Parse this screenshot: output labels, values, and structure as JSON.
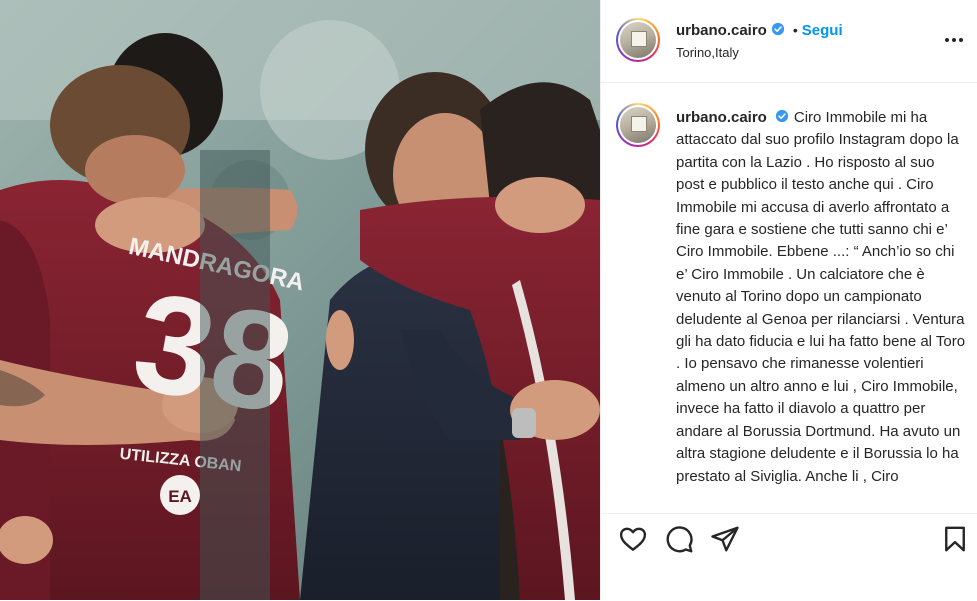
{
  "header": {
    "username": "urbano.cairo",
    "follow_label": "Segui",
    "location": "Torino,Italy"
  },
  "caption": {
    "username": "urbano.cairo",
    "text": "Ciro Immobile mi ha attaccato dal suo profilo Instagram dopo la partita con la Lazio . Ho risposto al suo post e pubblico il testo anche qui . Ciro Immobile mi accusa di averlo affrontato a fine gara e sostiene che tutti sanno chi e’ Ciro Immobile. Ebbene ...: “ Anch’io so chi e’ Ciro Immobile . Un calciatore che è venuto al Torino dopo un campionato deludente al Genoa per rilanciarsi . Ventura gli ha dato fiducia e lui ha fatto bene al Toro . Io pensavo che rimanesse volentieri almeno un altro anno e lui , Ciro Immobile, invece ha fatto il diavolo a quattro per andare al Borussia Dortmund. Ha avuto un altra stagione deludente e il Borussia lo ha prestato al Siviglia. Anche li , Ciro"
  },
  "photo": {
    "jersey_name": "MANDRAGORA",
    "jersey_number": "38",
    "sponsor": "UTILIZZA OBAN",
    "badge": "EA"
  },
  "icons": {
    "verified": "verified-badge-icon",
    "more": "more-options-icon",
    "like": "heart-icon",
    "comment": "comment-icon",
    "share": "share-icon",
    "save": "bookmark-icon"
  },
  "colors": {
    "accent": "#0095f6",
    "verified": "#3897f0",
    "jersey": "#7a1f2b"
  }
}
